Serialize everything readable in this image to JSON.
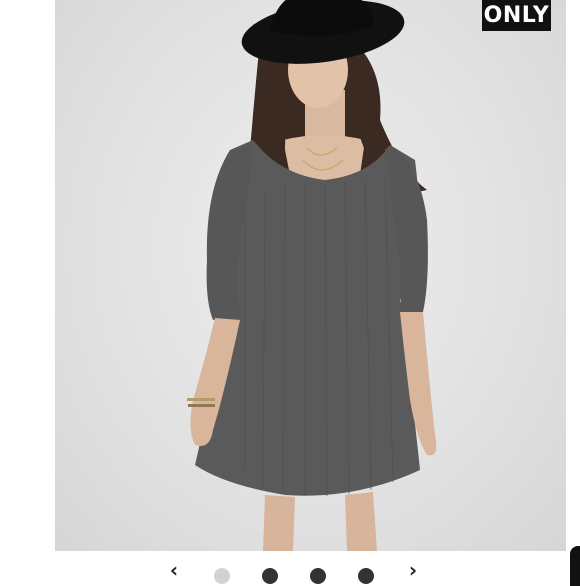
{
  "badge": {
    "label": "ONLY"
  },
  "photo": {
    "subject": "model-in-gray-dress",
    "dress_color": "#5a5a5a",
    "hat_color": "#111111",
    "background_color": "#e6e6e6"
  },
  "carousel": {
    "prev_icon": "chevron-left-icon",
    "next_icon": "chevron-right-icon",
    "prev_glyph": "‹",
    "next_glyph": "›",
    "dot_count": 4,
    "active_index": 1,
    "active_color": "#d2d2d2",
    "inactive_color": "#333333"
  }
}
